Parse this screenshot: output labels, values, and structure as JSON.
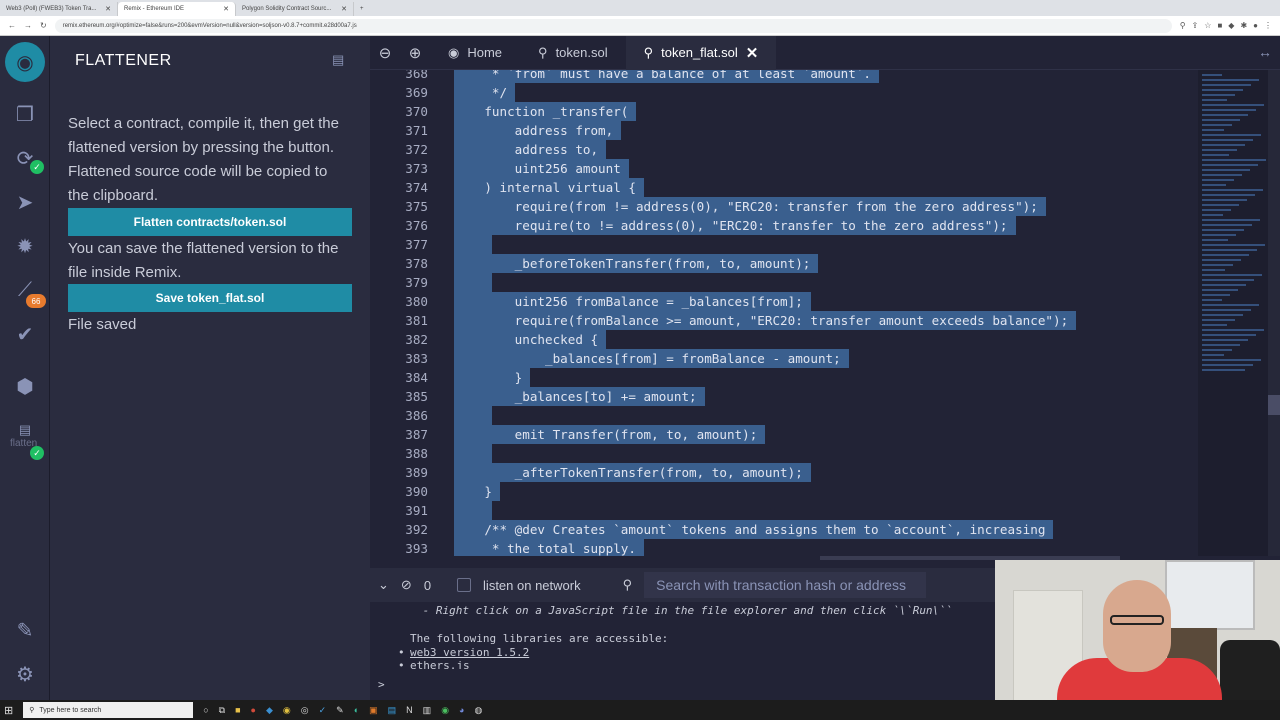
{
  "browser": {
    "tabs": [
      {
        "label": "Web3 (Poll) (FWEB3) Token Tra..."
      },
      {
        "label": "Remix - Ethereum IDE"
      },
      {
        "label": "Polygon Solidity Contract Sourc..."
      }
    ],
    "url": "remix.ethereum.org/#optimize=false&runs=200&evmVersion=null&version=soljson-v0.8.7+commit.e28d00a7.js"
  },
  "sidebar": {
    "badge_count": "66",
    "flattener_icon_label": "flatten"
  },
  "panel": {
    "title": "FLATTENER",
    "intro": "Select a contract, compile it, then get the flattened version by pressing the button. Flattened source code will be copied to the clipboard.",
    "flatten_button": "Flatten contracts/token.sol",
    "save_text": "You can save the flattened version to the file inside Remix.",
    "save_button": "Save token_flat.sol",
    "status": "File saved"
  },
  "editor": {
    "tabs": [
      {
        "label": "Home",
        "active": false
      },
      {
        "label": "token.sol",
        "active": false
      },
      {
        "label": "token_flat.sol",
        "active": true
      }
    ],
    "lines": [
      {
        "n": "368",
        "t": "     * `from` must have a balance of at least `amount`."
      },
      {
        "n": "369",
        "t": "     */"
      },
      {
        "n": "370",
        "t": "    function _transfer("
      },
      {
        "n": "371",
        "t": "        address from,"
      },
      {
        "n": "372",
        "t": "        address to,"
      },
      {
        "n": "373",
        "t": "        uint256 amount"
      },
      {
        "n": "374",
        "t": "    ) internal virtual {"
      },
      {
        "n": "375",
        "t": "        require(from != address(0), \"ERC20: transfer from the zero address\");"
      },
      {
        "n": "376",
        "t": "        require(to != address(0), \"ERC20: transfer to the zero address\");"
      },
      {
        "n": "377",
        "t": ""
      },
      {
        "n": "378",
        "t": "        _beforeTokenTransfer(from, to, amount);"
      },
      {
        "n": "379",
        "t": ""
      },
      {
        "n": "380",
        "t": "        uint256 fromBalance = _balances[from];"
      },
      {
        "n": "381",
        "t": "        require(fromBalance >= amount, \"ERC20: transfer amount exceeds balance\");"
      },
      {
        "n": "382",
        "t": "        unchecked {"
      },
      {
        "n": "383",
        "t": "            _balances[from] = fromBalance - amount;"
      },
      {
        "n": "384",
        "t": "        }"
      },
      {
        "n": "385",
        "t": "        _balances[to] += amount;"
      },
      {
        "n": "386",
        "t": ""
      },
      {
        "n": "387",
        "t": "        emit Transfer(from, to, amount);"
      },
      {
        "n": "388",
        "t": ""
      },
      {
        "n": "389",
        "t": "        _afterTokenTransfer(from, to, amount);"
      },
      {
        "n": "390",
        "t": "    }"
      },
      {
        "n": "391",
        "t": ""
      },
      {
        "n": "392",
        "t": "    /** @dev Creates `amount` tokens and assigns them to `account`, increasing"
      },
      {
        "n": "393",
        "t": "     * the total supply."
      }
    ]
  },
  "terminal": {
    "count": "0",
    "listen_label": "listen on network",
    "search_placeholder": "Search with transaction hash or address",
    "line1": " - Right click on a JavaScript file in the file explorer and then click `\\`Run\\``",
    "line2": "The following libraries are accessible:",
    "lib1": "web3 version 1.5.2",
    "lib2": "ethers.js",
    "prompt": ">"
  },
  "taskbar": {
    "search_placeholder": "Type here to search"
  },
  "colors": {
    "panel_bg": "#2a2c3f",
    "editor_bg": "#222336",
    "button": "#1f8ca5",
    "selection": "#3a5f8e"
  }
}
